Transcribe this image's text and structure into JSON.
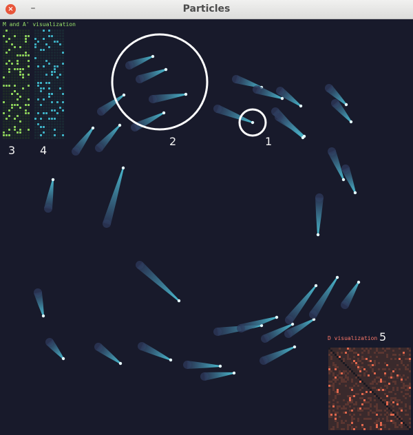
{
  "window": {
    "title": "Particles",
    "close_glyph": "×",
    "minimize_glyph": "–"
  },
  "overlay": {
    "ma_label": "M and A' visualization",
    "d_label": "D visualization",
    "callouts": [
      "1",
      "2",
      "3",
      "4",
      "5"
    ]
  },
  "colors": {
    "background": "#181a2b",
    "particle_head": "#e6fbff",
    "particle_tail": "#4dc3d8",
    "ma_label": "#9be36b",
    "d_label": "#ff7a6a",
    "callout_circle": "#ffffff"
  }
}
